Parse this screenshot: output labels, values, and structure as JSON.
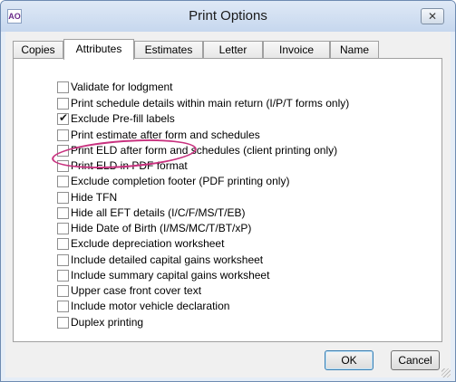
{
  "window": {
    "title": "Print Options",
    "app_icon_text": "AO",
    "close_glyph": "✕"
  },
  "tabs": [
    {
      "label": "Copies",
      "active": false
    },
    {
      "label": "Attributes",
      "active": true
    },
    {
      "label": "Estimates",
      "active": false
    },
    {
      "label": "Letter",
      "active": false
    },
    {
      "label": "Invoice",
      "active": false
    },
    {
      "label": "Name",
      "active": false
    }
  ],
  "options": [
    {
      "label": "Validate for lodgment",
      "checked": false
    },
    {
      "label": "Print schedule details within main return (I/P/T forms only)",
      "checked": false
    },
    {
      "label": "Exclude Pre-fill labels",
      "checked": true
    },
    {
      "label": "Print estimate after form and schedules",
      "checked": false
    },
    {
      "label": "Print ELD after form and schedules (client printing only)",
      "checked": false
    },
    {
      "label": "Print ELD in PDF format",
      "checked": false
    },
    {
      "label": "Exclude completion footer (PDF printing only)",
      "checked": false
    },
    {
      "label": "Hide TFN",
      "checked": false
    },
    {
      "label": "Hide all EFT details (I/C/F/MS/T/EB)",
      "checked": false
    },
    {
      "label": "Hide Date of Birth (I/MS/MC/T/BT/xP)",
      "checked": false
    },
    {
      "label": "Exclude depreciation worksheet",
      "checked": false
    },
    {
      "label": "Include detailed capital gains worksheet",
      "checked": false
    },
    {
      "label": "Include summary capital gains worksheet",
      "checked": false
    },
    {
      "label": "Upper case front cover text",
      "checked": false
    },
    {
      "label": "Include motor vehicle declaration",
      "checked": false
    },
    {
      "label": "Duplex printing",
      "checked": false
    }
  ],
  "buttons": {
    "ok": "OK",
    "cancel": "Cancel"
  },
  "colors": {
    "highlight": "#c8327f",
    "titlebar": "#c6d7ee"
  }
}
